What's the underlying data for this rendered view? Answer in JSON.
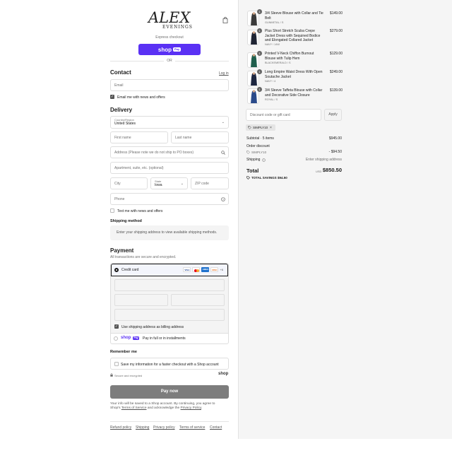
{
  "header": {
    "logo_main": "ALEX",
    "logo_sub": "EVENINGS"
  },
  "express": {
    "label": "Express checkout",
    "shop_word": "shop",
    "shop_pay": "Pay",
    "or_label": "OR"
  },
  "contact": {
    "title": "Contact",
    "login_link": "Log in",
    "email_placeholder": "Email",
    "news_label": "Email me with news and offers"
  },
  "delivery": {
    "title": "Delivery",
    "country_label": "Country/Region",
    "country_value": "United States",
    "first_name_placeholder": "First name",
    "last_name_placeholder": "Last name",
    "address_placeholder": "Address (Please note we do not ship to PO boxes)",
    "apartment_placeholder": "Apartment, suite, etc. (optional)",
    "city_placeholder": "City",
    "state_label": "State",
    "state_value": "Iowa",
    "zip_placeholder": "ZIP code",
    "phone_placeholder": "Phone",
    "text_news_label": "Text me with news and offers"
  },
  "shipping_method": {
    "title": "Shipping method",
    "message": "Enter your shipping address to view available shipping methods."
  },
  "payment": {
    "title": "Payment",
    "subtitle": "All transactions are secure and encrypted.",
    "credit_card_label": "Credit card",
    "cards": [
      "VISA",
      "MC",
      "AMEX",
      "DISC"
    ],
    "more_cards": "+6",
    "billing_label": "Use shipping address as billing address",
    "shoppay_label": "Pay in full or in installments",
    "shoppay_word": "shop",
    "shoppay_pill": "Pay"
  },
  "remember": {
    "title": "Remember me",
    "save_label": "Save my information for a faster checkout with a Shop account",
    "secure_label": "Secure and encrypted",
    "shop_brand": "shop"
  },
  "paynow_label": "Pay now",
  "disclaimer": {
    "line1": "Your info will be saved to a Shop account. By continuing, you agree to",
    "line2_a": "Shop's",
    "terms_link": "Terms of Service",
    "line2_b": "and acknowledge the",
    "privacy_link": "Privacy Policy",
    "line2_c": "."
  },
  "footer_links": [
    "Refund policy",
    "Shipping",
    "Privacy policy",
    "Terms of service",
    "Contact"
  ],
  "summary": {
    "items": [
      {
        "qty": "1",
        "name_1": "3/4 Sleeve Blouse with Collar and Tie",
        "name_2": "Belt",
        "name_3": "",
        "variant": "GUNMETAL / S",
        "price": "$149.00",
        "color": "#3a3a3a"
      },
      {
        "qty": "1",
        "name_1": "Plus Short Stretch Scuba Crepe",
        "name_2": "Jacket Dress with Sequined Bodice",
        "name_3": "and Elongated Collared Jacket",
        "variant": "NAVY / 14W",
        "price": "$279.00",
        "color": "#1f2433"
      },
      {
        "qty": "1",
        "name_1": "Printed V-Neck Chiffon Burnout",
        "name_2": "Blouse with Tulip Hem",
        "name_3": "",
        "variant": "BLACKEMERALD / S",
        "price": "$129.00",
        "color": "#1f5e4c"
      },
      {
        "qty": "1",
        "name_1": "Long Empire Waist Dress With Open",
        "name_2": "Soutache Jacket",
        "name_3": "",
        "variant": "NAVY / 4",
        "price": "$249.00",
        "color": "#1d2640"
      },
      {
        "qty": "1",
        "name_1": "3/4 Sleeve Taffeta Blouse with Collar",
        "name_2": "and Decorative Side Closure",
        "name_3": "",
        "variant": "ROYAL / S",
        "price": "$139.00",
        "color": "#2a4a8a"
      }
    ],
    "discount_placeholder": "Discount code or gift card",
    "apply_label": "Apply",
    "applied_code": "SIMPLY10",
    "subtotal_label": "Subtotal · 5 items",
    "subtotal_value": "$945.00",
    "order_discount_label": "Order discount",
    "discount_code": "SIMPLY10",
    "discount_value": "- $94.50",
    "shipping_label": "Shipping",
    "shipping_value": "Enter shipping address",
    "total_label": "Total",
    "currency": "USD",
    "total_value": "$850.50",
    "savings_label": "TOTAL SAVINGS",
    "savings_value": "$94.50"
  }
}
